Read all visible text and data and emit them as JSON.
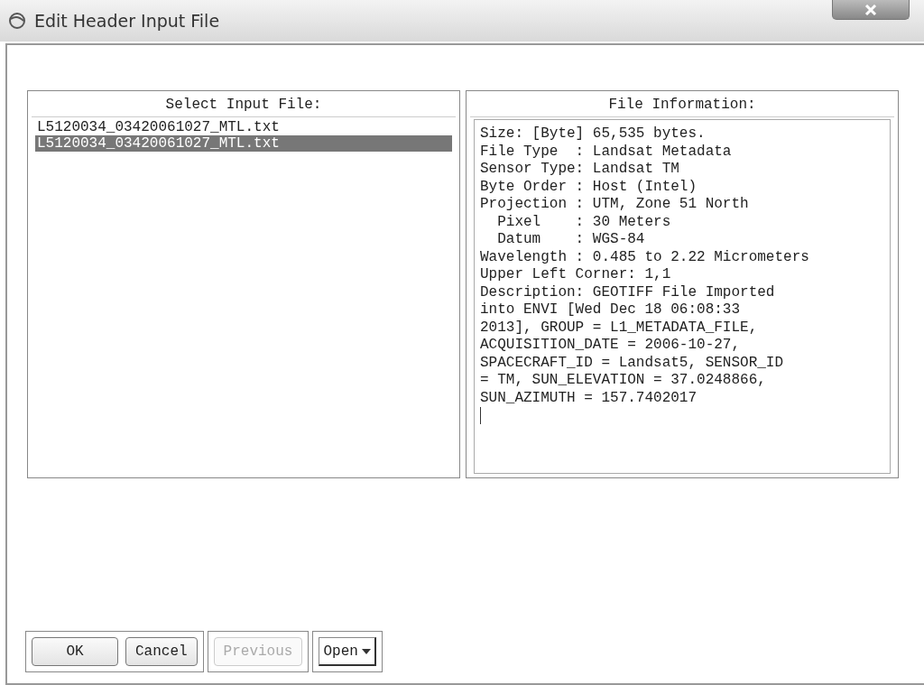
{
  "window": {
    "title": "Edit Header Input File"
  },
  "input_files": {
    "heading": "Select Input File:",
    "items": [
      {
        "name": "L5120034_03420061027_MTL.txt",
        "selected": false
      },
      {
        "name": "L5120034_03420061027_MTL.txt",
        "selected": true
      }
    ]
  },
  "file_information": {
    "heading": "File Information:",
    "lines": [
      "Size: [Byte] 65,535 bytes.",
      "File Type  : Landsat Metadata",
      "Sensor Type: Landsat TM",
      "Byte Order : Host (Intel)",
      "Projection : UTM, Zone 51 North",
      "  Pixel    : 30 Meters",
      "  Datum    : WGS-84",
      "Wavelength : 0.485 to 2.22 Micrometers",
      "Upper Left Corner: 1,1",
      "Description: GEOTIFF File Imported",
      "into ENVI [Wed Dec 18 06:08:33",
      "2013], GROUP = L1_METADATA_FILE,",
      "ACQUISITION_DATE = 2006-10-27,",
      "SPACECRAFT_ID = Landsat5, SENSOR_ID",
      "= TM, SUN_ELEVATION = 37.0248866,",
      "SUN_AZIMUTH = 157.7402017"
    ]
  },
  "buttons": [
    {
      "label": "OK",
      "kind": "push",
      "disabled": false
    },
    {
      "label": "Cancel",
      "kind": "push",
      "disabled": false
    },
    {
      "label": "Previous",
      "kind": "push",
      "disabled": true
    },
    {
      "label": "Open",
      "kind": "menu",
      "disabled": false
    }
  ]
}
